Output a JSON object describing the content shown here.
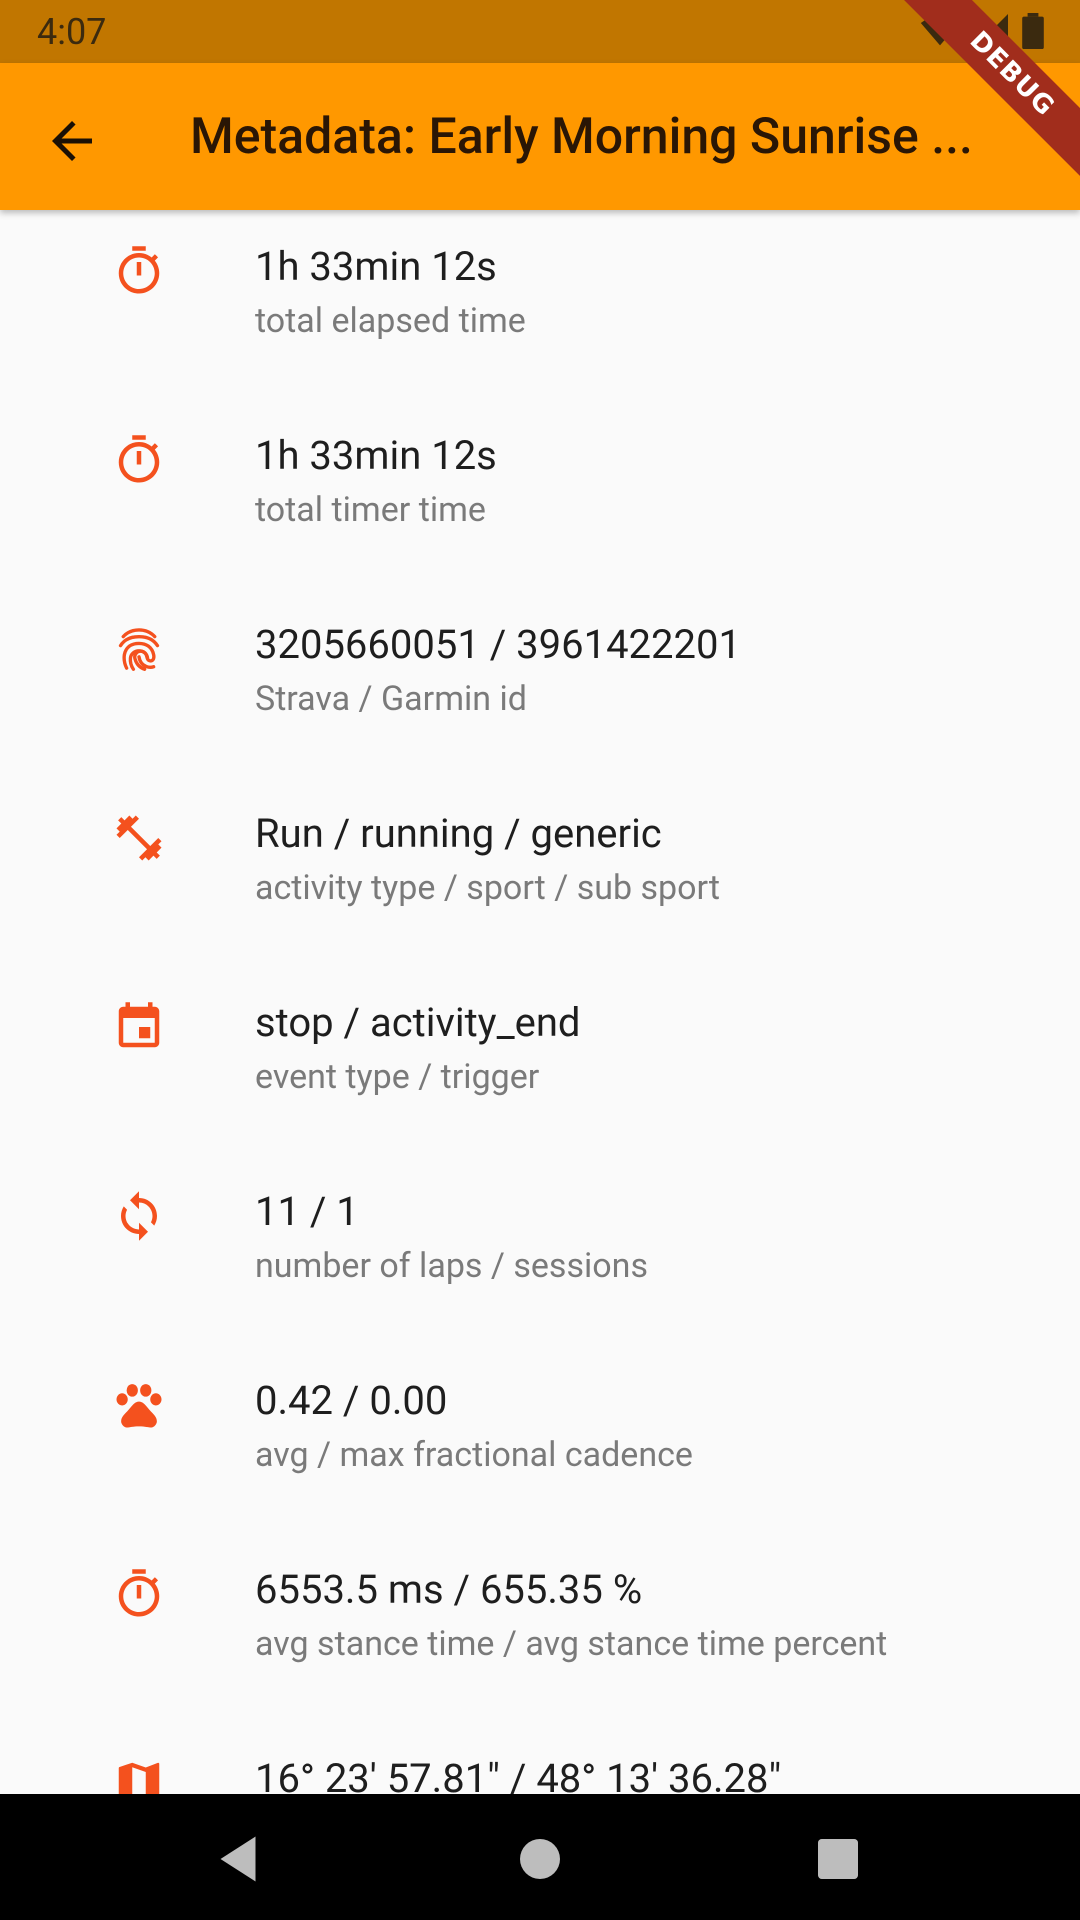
{
  "status_bar": {
    "time": "4:07"
  },
  "app_bar": {
    "title": "Metadata: Early Morning Sunrise ...",
    "debug_label": "DEBUG"
  },
  "colors": {
    "accent": "#ff9800",
    "icon": "#f4511e",
    "status_bar": "#c17600"
  },
  "items": [
    {
      "icon": "timer-icon",
      "title": "1h 33min 12s",
      "subtitle": "total elapsed time"
    },
    {
      "icon": "timer-icon",
      "title": "1h 33min 12s",
      "subtitle": "total timer time"
    },
    {
      "icon": "fingerprint-icon",
      "title": "3205660051 / 3961422201",
      "subtitle": "Strava / Garmin id"
    },
    {
      "icon": "fitness-center-icon",
      "title": "Run / running / generic",
      "subtitle": "activity type / sport / sub sport"
    },
    {
      "icon": "event-icon",
      "title": "stop / activity_end",
      "subtitle": "event type / trigger"
    },
    {
      "icon": "loop-icon",
      "title": "11 / 1",
      "subtitle": "number of laps / sessions"
    },
    {
      "icon": "paw-icon",
      "title": "0.42 / 0.00",
      "subtitle": "avg / max fractional cadence"
    },
    {
      "icon": "timer-icon",
      "title": "6553.5 ms / 655.35 %",
      "subtitle": "avg stance time / avg stance time percent"
    },
    {
      "icon": "map-icon",
      "title": "16° 23' 57.81\"   /   48° 13' 36.28\"",
      "subtitle": ""
    }
  ]
}
